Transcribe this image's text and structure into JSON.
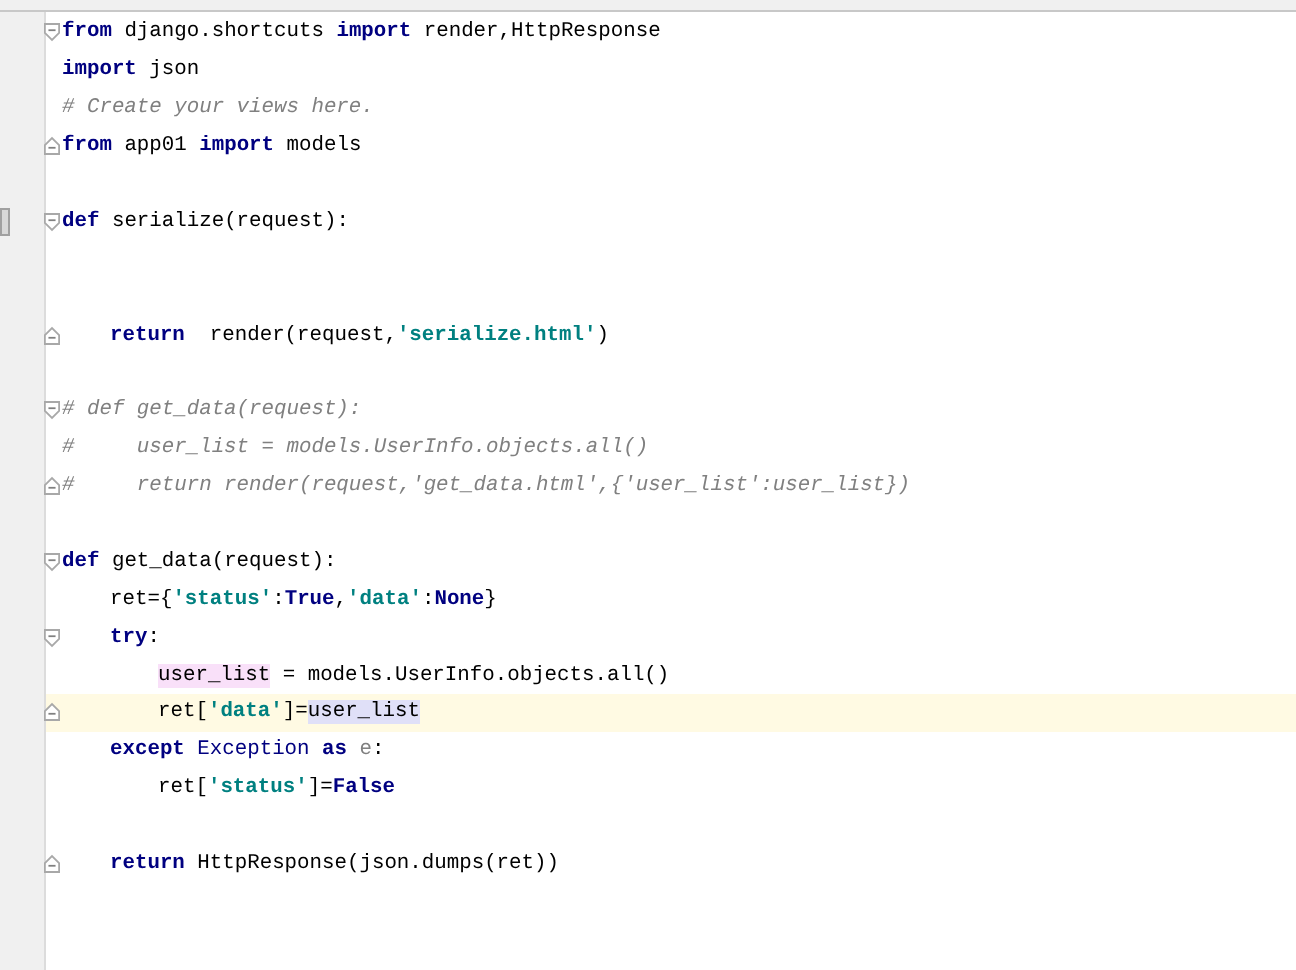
{
  "editor": {
    "lines": [
      {
        "kind": "code",
        "fold_start": true,
        "tokens": [
          {
            "kind": "keyword",
            "text": "from"
          },
          {
            "kind": "plain",
            "text": " django.shortcuts "
          },
          {
            "kind": "keyword",
            "text": "import"
          },
          {
            "kind": "plain",
            "text": " render,HttpResponse"
          }
        ]
      },
      {
        "kind": "code",
        "tokens": [
          {
            "kind": "keyword",
            "text": "import"
          },
          {
            "kind": "plain",
            "text": " json"
          }
        ]
      },
      {
        "kind": "code",
        "tokens": [
          {
            "kind": "comment",
            "text": "# Create your views here."
          }
        ]
      },
      {
        "kind": "code",
        "fold_end": true,
        "tokens": [
          {
            "kind": "keyword",
            "text": "from"
          },
          {
            "kind": "plain",
            "text": " app01 "
          },
          {
            "kind": "keyword",
            "text": "import"
          },
          {
            "kind": "plain",
            "text": " models"
          }
        ]
      },
      {
        "kind": "blank"
      },
      {
        "kind": "code",
        "fold_start": true,
        "gutter_mark": true,
        "tokens": [
          {
            "kind": "keyword",
            "text": "def"
          },
          {
            "kind": "plain",
            "text": " serialize(request):"
          }
        ],
        "children": [
          {
            "kind": "blank"
          },
          {
            "kind": "blank"
          },
          {
            "kind": "code",
            "fold_end": true,
            "tokens": [
              {
                "kind": "keyword",
                "text": "return"
              },
              {
                "kind": "plain",
                "text": "  render(request,"
              },
              {
                "kind": "string",
                "text": "'serialize.html'"
              },
              {
                "kind": "plain",
                "text": ")"
              }
            ]
          }
        ]
      },
      {
        "kind": "blank"
      },
      {
        "kind": "code",
        "fold_start": true,
        "tokens": [
          {
            "kind": "comment",
            "text": "# def get_data(request):"
          }
        ]
      },
      {
        "kind": "code",
        "tokens": [
          {
            "kind": "comment",
            "text": "#     user_list = models.UserInfo.objects.all()"
          }
        ]
      },
      {
        "kind": "code",
        "fold_end": true,
        "tokens": [
          {
            "kind": "comment",
            "text": "#     return render(request,'get_data.html',{'user_list':user_list})"
          }
        ]
      },
      {
        "kind": "blank"
      },
      {
        "kind": "code",
        "fold_start": true,
        "tokens": [
          {
            "kind": "keyword",
            "text": "def"
          },
          {
            "kind": "plain",
            "text": " get_data(request):"
          }
        ],
        "children": [
          {
            "kind": "code",
            "tokens": [
              {
                "kind": "plain",
                "text": "ret={"
              },
              {
                "kind": "string",
                "text": "'status'"
              },
              {
                "kind": "plain",
                "text": ":"
              },
              {
                "kind": "keyword",
                "text": "True"
              },
              {
                "kind": "plain",
                "text": ","
              },
              {
                "kind": "string",
                "text": "'data'"
              },
              {
                "kind": "plain",
                "text": ":"
              },
              {
                "kind": "keyword",
                "text": "None"
              },
              {
                "kind": "plain",
                "text": "}"
              }
            ]
          },
          {
            "kind": "code",
            "fold_start": true,
            "tokens": [
              {
                "kind": "keyword",
                "text": "try"
              },
              {
                "kind": "plain",
                "text": ":"
              }
            ],
            "children": [
              {
                "kind": "code",
                "tokens": [
                  {
                    "kind": "plain",
                    "text": "user_list",
                    "color": "#f9e0f9"
                  },
                  {
                    "kind": "plain",
                    "text": " = models.UserInfo.objects.all()"
                  }
                ]
              },
              {
                "kind": "code",
                "fold_end": true,
                "current": true,
                "tokens": [
                  {
                    "kind": "plain",
                    "text": "ret["
                  },
                  {
                    "kind": "string",
                    "text": "'data'"
                  },
                  {
                    "kind": "plain",
                    "text": "]="
                  },
                  {
                    "kind": "plain",
                    "text": "user_list",
                    "color": "#e0e0f8"
                  }
                ]
              }
            ]
          },
          {
            "kind": "code",
            "tokens": [
              {
                "kind": "keyword",
                "text": "except"
              },
              {
                "kind": "builtin",
                "text": " Exception"
              },
              {
                "kind": "keyword",
                "text": " as"
              },
              {
                "kind": "unused",
                "text": " e"
              },
              {
                "kind": "plain",
                "text": ":"
              }
            ],
            "children": [
              {
                "kind": "code",
                "tokens": [
                  {
                    "kind": "plain",
                    "text": "ret["
                  },
                  {
                    "kind": "string",
                    "text": "'status'"
                  },
                  {
                    "kind": "plain",
                    "text": "]="
                  },
                  {
                    "kind": "keyword",
                    "text": "False"
                  }
                ]
              }
            ]
          },
          {
            "kind": "blank"
          },
          {
            "kind": "code",
            "fold_end": true,
            "tokens": [
              {
                "kind": "keyword",
                "text": "return"
              },
              {
                "kind": "plain",
                "text": " HttpResponse(json.dumps(ret))"
              }
            ]
          }
        ]
      }
    ]
  }
}
